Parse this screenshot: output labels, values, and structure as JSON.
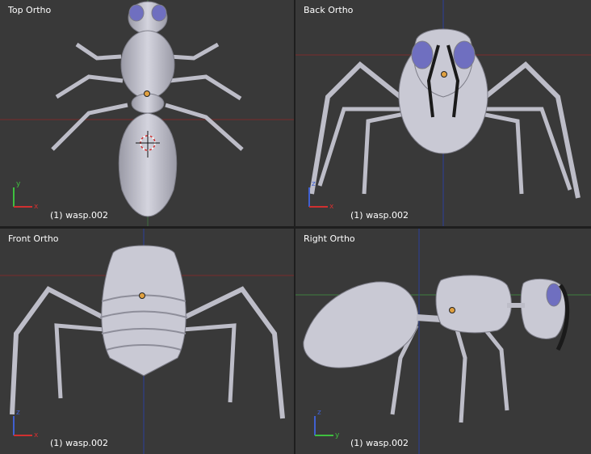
{
  "viewports": [
    {
      "title": "Top Ortho",
      "object": "(1) wasp.002",
      "gizmo": {
        "up": "y",
        "right": "x"
      }
    },
    {
      "title": "Back Ortho",
      "object": "(1) wasp.002",
      "gizmo": {
        "up": "z",
        "right": "x"
      }
    },
    {
      "title": "Front Ortho",
      "object": "(1) wasp.002",
      "gizmo": {
        "up": "z",
        "right": "x"
      }
    },
    {
      "title": "Right Ortho",
      "object": "(1) wasp.002",
      "gizmo": {
        "up": "z",
        "right": "y"
      }
    }
  ],
  "colors": {
    "viewport_bg": "#393939",
    "divider": "#1e1e1e",
    "axis_x": "#8a2b2b",
    "axis_y": "#3f7f3f",
    "axis_z": "#2b3f9a",
    "mesh": "#c9c9d4",
    "mesh_shade": "#8e8e9a",
    "eyes": "#6f6fc0",
    "origin": "#e0a040"
  }
}
